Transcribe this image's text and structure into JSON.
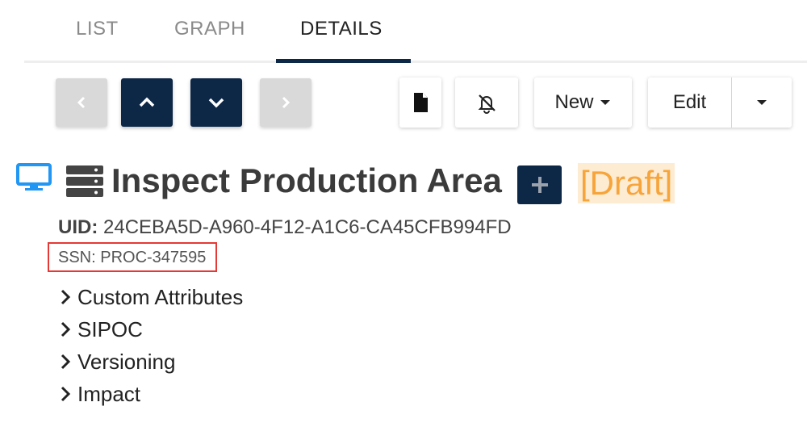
{
  "tabs": [
    {
      "label": "LIST"
    },
    {
      "label": "GRAPH"
    },
    {
      "label": "DETAILS",
      "active": true
    }
  ],
  "toolbar": {
    "nav_icons": [
      "chevron-left-icon",
      "chevron-up-icon",
      "chevron-down-icon",
      "chevron-right-icon"
    ],
    "document_icon": "document-icon",
    "notifications_icon": "notifications-off-icon",
    "new_label": "New",
    "edit_label": "Edit"
  },
  "heading": {
    "icons": [
      "monitor-icon",
      "server-icon"
    ],
    "title": "Inspect Production Area",
    "add_icon": "plus-icon",
    "status": "[Draft]"
  },
  "meta": {
    "uid_label": "UID:",
    "uid_value": "24CEBA5D-A960-4F12-A1C6-CA45CFB994FD",
    "ssn": "SSN: PROC-347595"
  },
  "sections": [
    {
      "label": "Custom Attributes"
    },
    {
      "label": "SIPOC"
    },
    {
      "label": "Versioning"
    },
    {
      "label": "Impact"
    }
  ],
  "colors": {
    "primary": "#0d2747",
    "disabled": "#d9d9d9",
    "monitor_icon": "#2196f3",
    "draft_text": "#f7a43a",
    "draft_bg": "#fdebd2",
    "highlight_border": "#e53935"
  }
}
